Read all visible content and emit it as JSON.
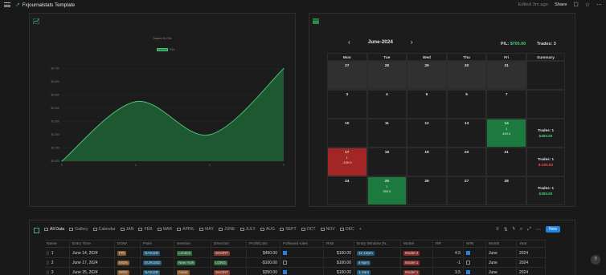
{
  "topbar": {
    "title": "Fxjournalstats Template",
    "edited": "Edited 3m ago",
    "share": "Share"
  },
  "chart": {
    "legend_title": "Trades Vs P&L",
    "legend_series": "P&L"
  },
  "chart_data": {
    "type": "area",
    "title": "Trades Vs P&L",
    "xlabel": "",
    "ylabel": "",
    "x": [
      0,
      1,
      2,
      3
    ],
    "x_ticks": [
      "0",
      "1",
      "2",
      "3"
    ],
    "y_ticks": [
      "$0.000",
      "$0.100",
      "$0.200",
      "$0.300",
      "$0.400",
      "$0.500",
      "$0.600",
      "$0.700"
    ],
    "series": [
      {
        "name": "P&L",
        "values": [
          0,
          450,
          200,
          700
        ]
      }
    ],
    "ylim": [
      0,
      800
    ],
    "grid": true,
    "legend": "top-center",
    "color": "#2d8a4e"
  },
  "calendar": {
    "month": "June-2024",
    "pl_label": "P/L:",
    "pl_value": "$700.00",
    "trades_label": "Trades:",
    "trades_value": "3",
    "days": [
      "Mon",
      "Tue",
      "Wed",
      "Thu",
      "Fri",
      "Summary"
    ],
    "weeks": [
      {
        "cells": [
          {
            "d": "27",
            "m": true
          },
          {
            "d": "28",
            "m": true
          },
          {
            "d": "29",
            "m": true
          },
          {
            "d": "30",
            "m": true
          },
          {
            "d": "31",
            "m": true
          }
        ],
        "summary": null
      },
      {
        "cells": [
          {
            "d": "3"
          },
          {
            "d": "4"
          },
          {
            "d": "5"
          },
          {
            "d": "6"
          },
          {
            "d": "7"
          }
        ],
        "summary": null
      },
      {
        "cells": [
          {
            "d": "10"
          },
          {
            "d": "11"
          },
          {
            "d": "12"
          },
          {
            "d": "13"
          },
          {
            "d": "14",
            "c": "green",
            "n": "1",
            "v": "450.0"
          }
        ],
        "summary": {
          "t": "Trades:  1",
          "v": "$450.00",
          "pos": true
        }
      },
      {
        "cells": [
          {
            "d": "17",
            "c": "red",
            "n": "1",
            "v": "-100.0"
          },
          {
            "d": "18"
          },
          {
            "d": "19"
          },
          {
            "d": "20"
          },
          {
            "d": "21"
          }
        ],
        "summary": {
          "t": "Trades:  1",
          "v": "$-100.00",
          "pos": false
        }
      },
      {
        "cells": [
          {
            "d": "24"
          },
          {
            "d": "25",
            "c": "green",
            "n": "1",
            "v": "350.0"
          },
          {
            "d": "26"
          },
          {
            "d": "27"
          },
          {
            "d": "28"
          }
        ],
        "summary": {
          "t": "Trades:  1",
          "v": "$350.00",
          "pos": true
        }
      }
    ]
  },
  "db": {
    "tabs": [
      "All Data",
      "Gallery",
      "Calendar",
      "JAN",
      "FEB",
      "MAR",
      "APRIL",
      "MAY",
      "JUNE",
      "JULY",
      "AUG",
      "SEPT",
      "OCT",
      "NOV",
      "DEC"
    ],
    "new_label": "New",
    "columns": [
      "Name",
      "Entry Time",
      "DOW",
      "Pairs",
      "Session",
      "Direction",
      "Profit/Loss",
      "Followed rules",
      "Risk",
      "Entry Window (N...",
      "Model",
      "RR",
      "WIN",
      "Month",
      "Year"
    ],
    "rows": [
      {
        "name": "1",
        "entry": "June 14, 2024",
        "dow": "FRI",
        "pair": "NAS100",
        "session": "London",
        "dir": "SHORT",
        "pl": "$450.00",
        "rules": true,
        "risk": "$100.00",
        "window": "11-12pm",
        "model": "Model 2",
        "rr": "4.5",
        "win": true,
        "month": "June",
        "year": "2024"
      },
      {
        "name": "2",
        "entry": "June 17, 2024",
        "dow": "MON",
        "pair": "EURUSD",
        "session": "New York",
        "dir": "LONG",
        "pl": "-$100.00",
        "rules": false,
        "risk": "$100.00",
        "window": "4-5pm",
        "model": "Model 1",
        "rr": "-1",
        "win": false,
        "month": "June",
        "year": "2024"
      },
      {
        "name": "3",
        "entry": "June 25, 2024",
        "dow": "WED",
        "pair": "NAS100",
        "session": "Asian",
        "dir": "SHORT",
        "pl": "$350.00",
        "rules": true,
        "risk": "$100.00",
        "window": "1-2am",
        "model": "Model 1",
        "rr": "3.5",
        "win": true,
        "month": "June",
        "year": "2024"
      }
    ]
  }
}
